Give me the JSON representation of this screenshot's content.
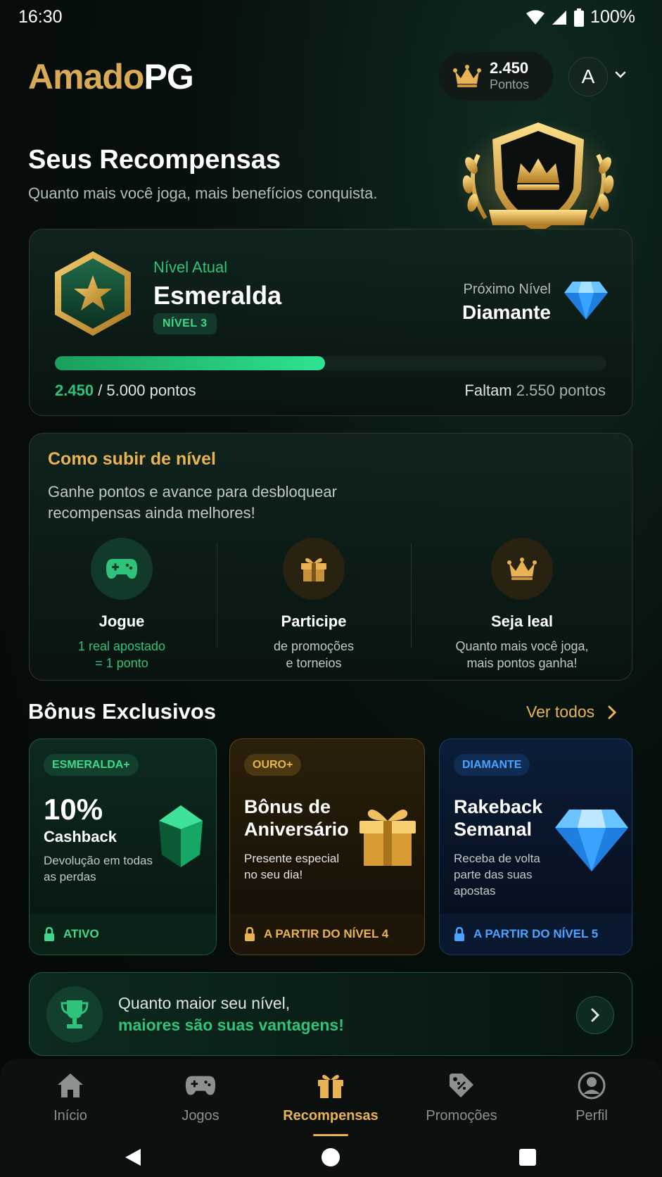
{
  "status": {
    "time": "16:30",
    "battery": "100%"
  },
  "header": {
    "logo_part1": "Amado",
    "logo_part2": "PG",
    "points_value": "2.450",
    "points_label": "Pontos",
    "avatar_initial": "A"
  },
  "hero": {
    "title": "Seus Recompensas",
    "subtitle": "Quanto mais você joga, mais benefícios conquista."
  },
  "level": {
    "current_label": "Nível Atual",
    "current_name": "Esmeralda",
    "current_chip": "NÍVEL 3",
    "next_label": "Próximo Nível",
    "next_name": "Diamante",
    "progress_fraction": 0.49,
    "progress_current": "2.450",
    "progress_total": "/ 5.000 pontos",
    "remaining_prefix": "Faltam",
    "remaining_value": "2.550 pontos"
  },
  "how": {
    "title": "Como subir de nível",
    "description": "Ganhe pontos e avance para desbloquear recompensas ainda melhores!",
    "steps": [
      {
        "title": "Jogue",
        "line1": "1 real apostado",
        "line2": "= 1 ponto",
        "icon": "gamepad-icon"
      },
      {
        "title": "Participe",
        "line1": "de promoções",
        "line2": "e torneios",
        "icon": "gift-icon"
      },
      {
        "title": "Seja leal",
        "line1": "Quanto mais você joga,",
        "line2": "mais pontos ganha!",
        "icon": "crown-icon"
      }
    ]
  },
  "bonus": {
    "title": "Bônus Exclusivos",
    "see_all": "Ver todos",
    "cards": [
      {
        "chip": "ESMERALDA+",
        "big": "10%",
        "sub": "Cashback",
        "desc1": "Devolução em todas",
        "desc2": "as perdas",
        "footer": "ATIVO"
      },
      {
        "chip": "OURO+",
        "title1": "Bônus de",
        "title2": "Aniversário",
        "desc1": "Presente especial",
        "desc2": "no seu dia!",
        "footer": "A PARTIR DO NÍVEL 4"
      },
      {
        "chip": "DIAMANTE",
        "title1": "Rakeback",
        "title2": "Semanal",
        "desc1": "Receba de volta",
        "desc2": "parte das suas",
        "desc3": "apostas",
        "footer": "A PARTIR DO NÍVEL 5"
      }
    ]
  },
  "banner": {
    "line1": "Quanto maior seu nível,",
    "line2": "maiores são suas vantagens!"
  },
  "nav": {
    "items": [
      {
        "label": "Início",
        "icon": "home-icon"
      },
      {
        "label": "Jogos",
        "icon": "gamepad-icon"
      },
      {
        "label": "Recompensas",
        "icon": "gift-icon",
        "active": true
      },
      {
        "label": "Promoções",
        "icon": "tag-icon"
      },
      {
        "label": "Perfil",
        "icon": "profile-icon"
      }
    ]
  },
  "colors": {
    "gold": "#e8b352",
    "green": "#2fc27a",
    "blue": "#4aa3ff",
    "background": "#050807"
  }
}
